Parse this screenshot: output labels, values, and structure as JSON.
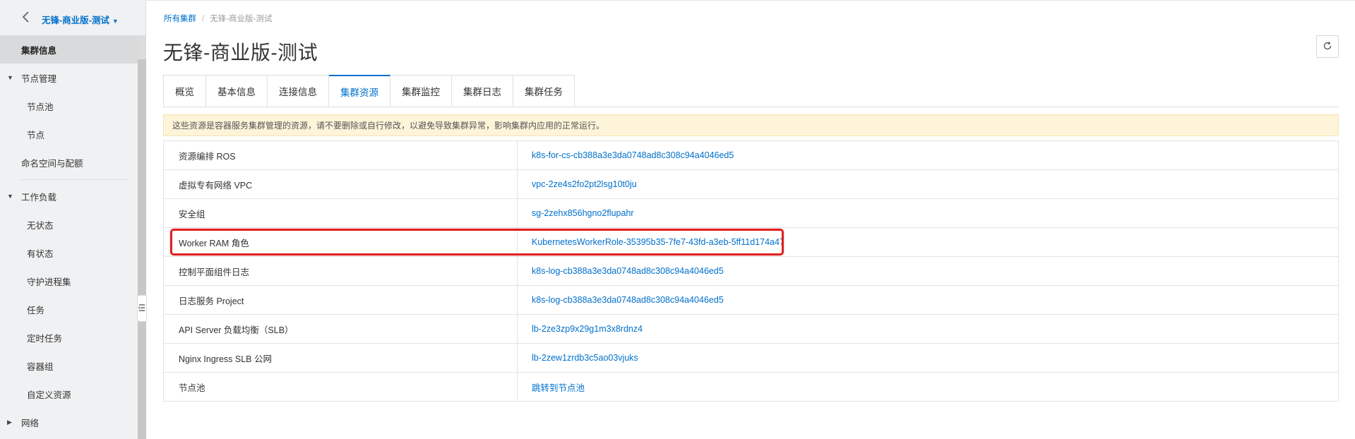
{
  "sidebar": {
    "cluster_name": "无锋-商业版-测试",
    "items": [
      {
        "label": "集群信息"
      },
      {
        "label": "节点管理"
      },
      {
        "label": "节点池"
      },
      {
        "label": "节点"
      },
      {
        "label": "命名空间与配额"
      },
      {
        "label": "工作负载"
      },
      {
        "label": "无状态"
      },
      {
        "label": "有状态"
      },
      {
        "label": "守护进程集"
      },
      {
        "label": "任务"
      },
      {
        "label": "定时任务"
      },
      {
        "label": "容器组"
      },
      {
        "label": "自定义资源"
      },
      {
        "label": "网络"
      }
    ]
  },
  "breadcrumb": {
    "root": "所有集群",
    "separator": "/",
    "current": "无锋-商业版-测试"
  },
  "page_title": "无锋-商业版-测试",
  "tabs": [
    {
      "label": "概览"
    },
    {
      "label": "基本信息"
    },
    {
      "label": "连接信息"
    },
    {
      "label": "集群资源"
    },
    {
      "label": "集群监控"
    },
    {
      "label": "集群日志"
    },
    {
      "label": "集群任务"
    }
  ],
  "notice": "这些资源是容器服务集群管理的资源，请不要删除或自行修改，以避免导致集群异常，影响集群内应用的正常运行。",
  "resources": [
    {
      "key": "资源编排 ROS",
      "value": "k8s-for-cs-cb388a3e3da0748ad8c308c94a4046ed5"
    },
    {
      "key": "虚拟专有网络 VPC",
      "value": "vpc-2ze4s2fo2pt2lsg10t0ju"
    },
    {
      "key": "安全组",
      "value": "sg-2zehx856hgno2flupahr"
    },
    {
      "key": "Worker RAM 角色",
      "value": "KubernetesWorkerRole-35395b35-7fe7-43fd-a3eb-5ff11d174a47"
    },
    {
      "key": "控制平面组件日志",
      "value": "k8s-log-cb388a3e3da0748ad8c308c94a4046ed5"
    },
    {
      "key": "日志服务 Project",
      "value": "k8s-log-cb388a3e3da0748ad8c308c94a4046ed5"
    },
    {
      "key": "API Server 负载均衡（SLB）",
      "value": "lb-2ze3zp9x29g1m3x8rdnz4"
    },
    {
      "key": "Nginx Ingress SLB 公网",
      "value": "lb-2zew1zrdb3c5ao03vjuks"
    },
    {
      "key": "节点池",
      "value": "跳转到节点池"
    }
  ],
  "colors": {
    "link": "#0070cc",
    "highlight_box": "#e02020",
    "notice_bg": "#fdf4d9"
  }
}
